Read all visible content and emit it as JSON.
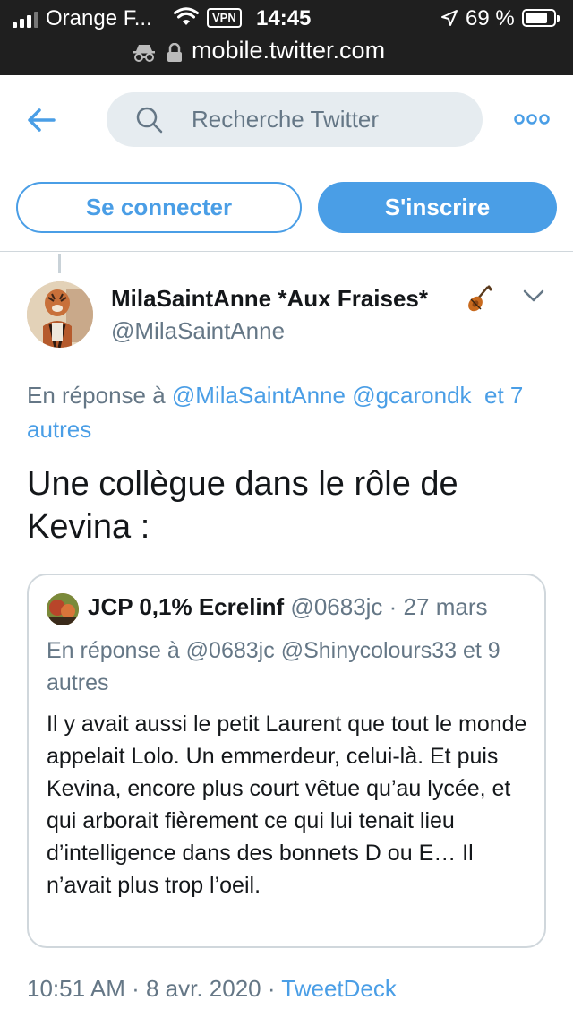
{
  "status_bar": {
    "carrier": "Orange F...",
    "vpn": "VPN",
    "time": "14:45",
    "battery": "69 %"
  },
  "browser": {
    "url": "mobile.twitter.com"
  },
  "header": {
    "search_placeholder": "Recherche Twitter",
    "login_label": "Se connecter",
    "signup_label": "S'inscrire"
  },
  "tweet": {
    "author_name": "MilaSaintAnne *Aux Fraises*",
    "author_handle": "@MilaSaintAnne",
    "reply_prefix": "En réponse à",
    "reply_mention_1": "@MilaSaintAnne",
    "reply_mention_2": "@gcarondk",
    "reply_more": "et 7 autres",
    "text": "Une collègue dans le rôle de Kevina :",
    "timestamp": "10:51 AM · 8 avr. 2020 ·",
    "source": "TweetDeck"
  },
  "quoted_tweet": {
    "author_name": "JCP 0,1% Ecrelinf",
    "author_handle": "@0683jc",
    "date": "· 27 mars",
    "reply_prefix": "En réponse à",
    "reply_mention_1": "@0683jc",
    "reply_mention_2": "@Shinycolours33",
    "reply_more": "et 9 autres",
    "text": "Il y avait aussi le petit Laurent que tout le monde appelait Lolo. Un emmerdeur, celui-là. Et puis Kevina, encore plus court vêtue qu’au lycée, et qui arborait fièrement ce qui lui tenait lieu d’intelligence dans des bonnets D ou E… Il n’avait plus trop l’oeil."
  },
  "colors": {
    "twitter_blue": "#4a9ee6",
    "secondary_text": "#657786",
    "border": "#d0d7dc",
    "status_bar_bg": "#1f1f1f"
  },
  "icons": {
    "back": "arrow-left-icon",
    "search": "search-icon",
    "more": "more-dots-icon",
    "caret": "chevron-down-icon",
    "emoji": "violin-icon"
  }
}
